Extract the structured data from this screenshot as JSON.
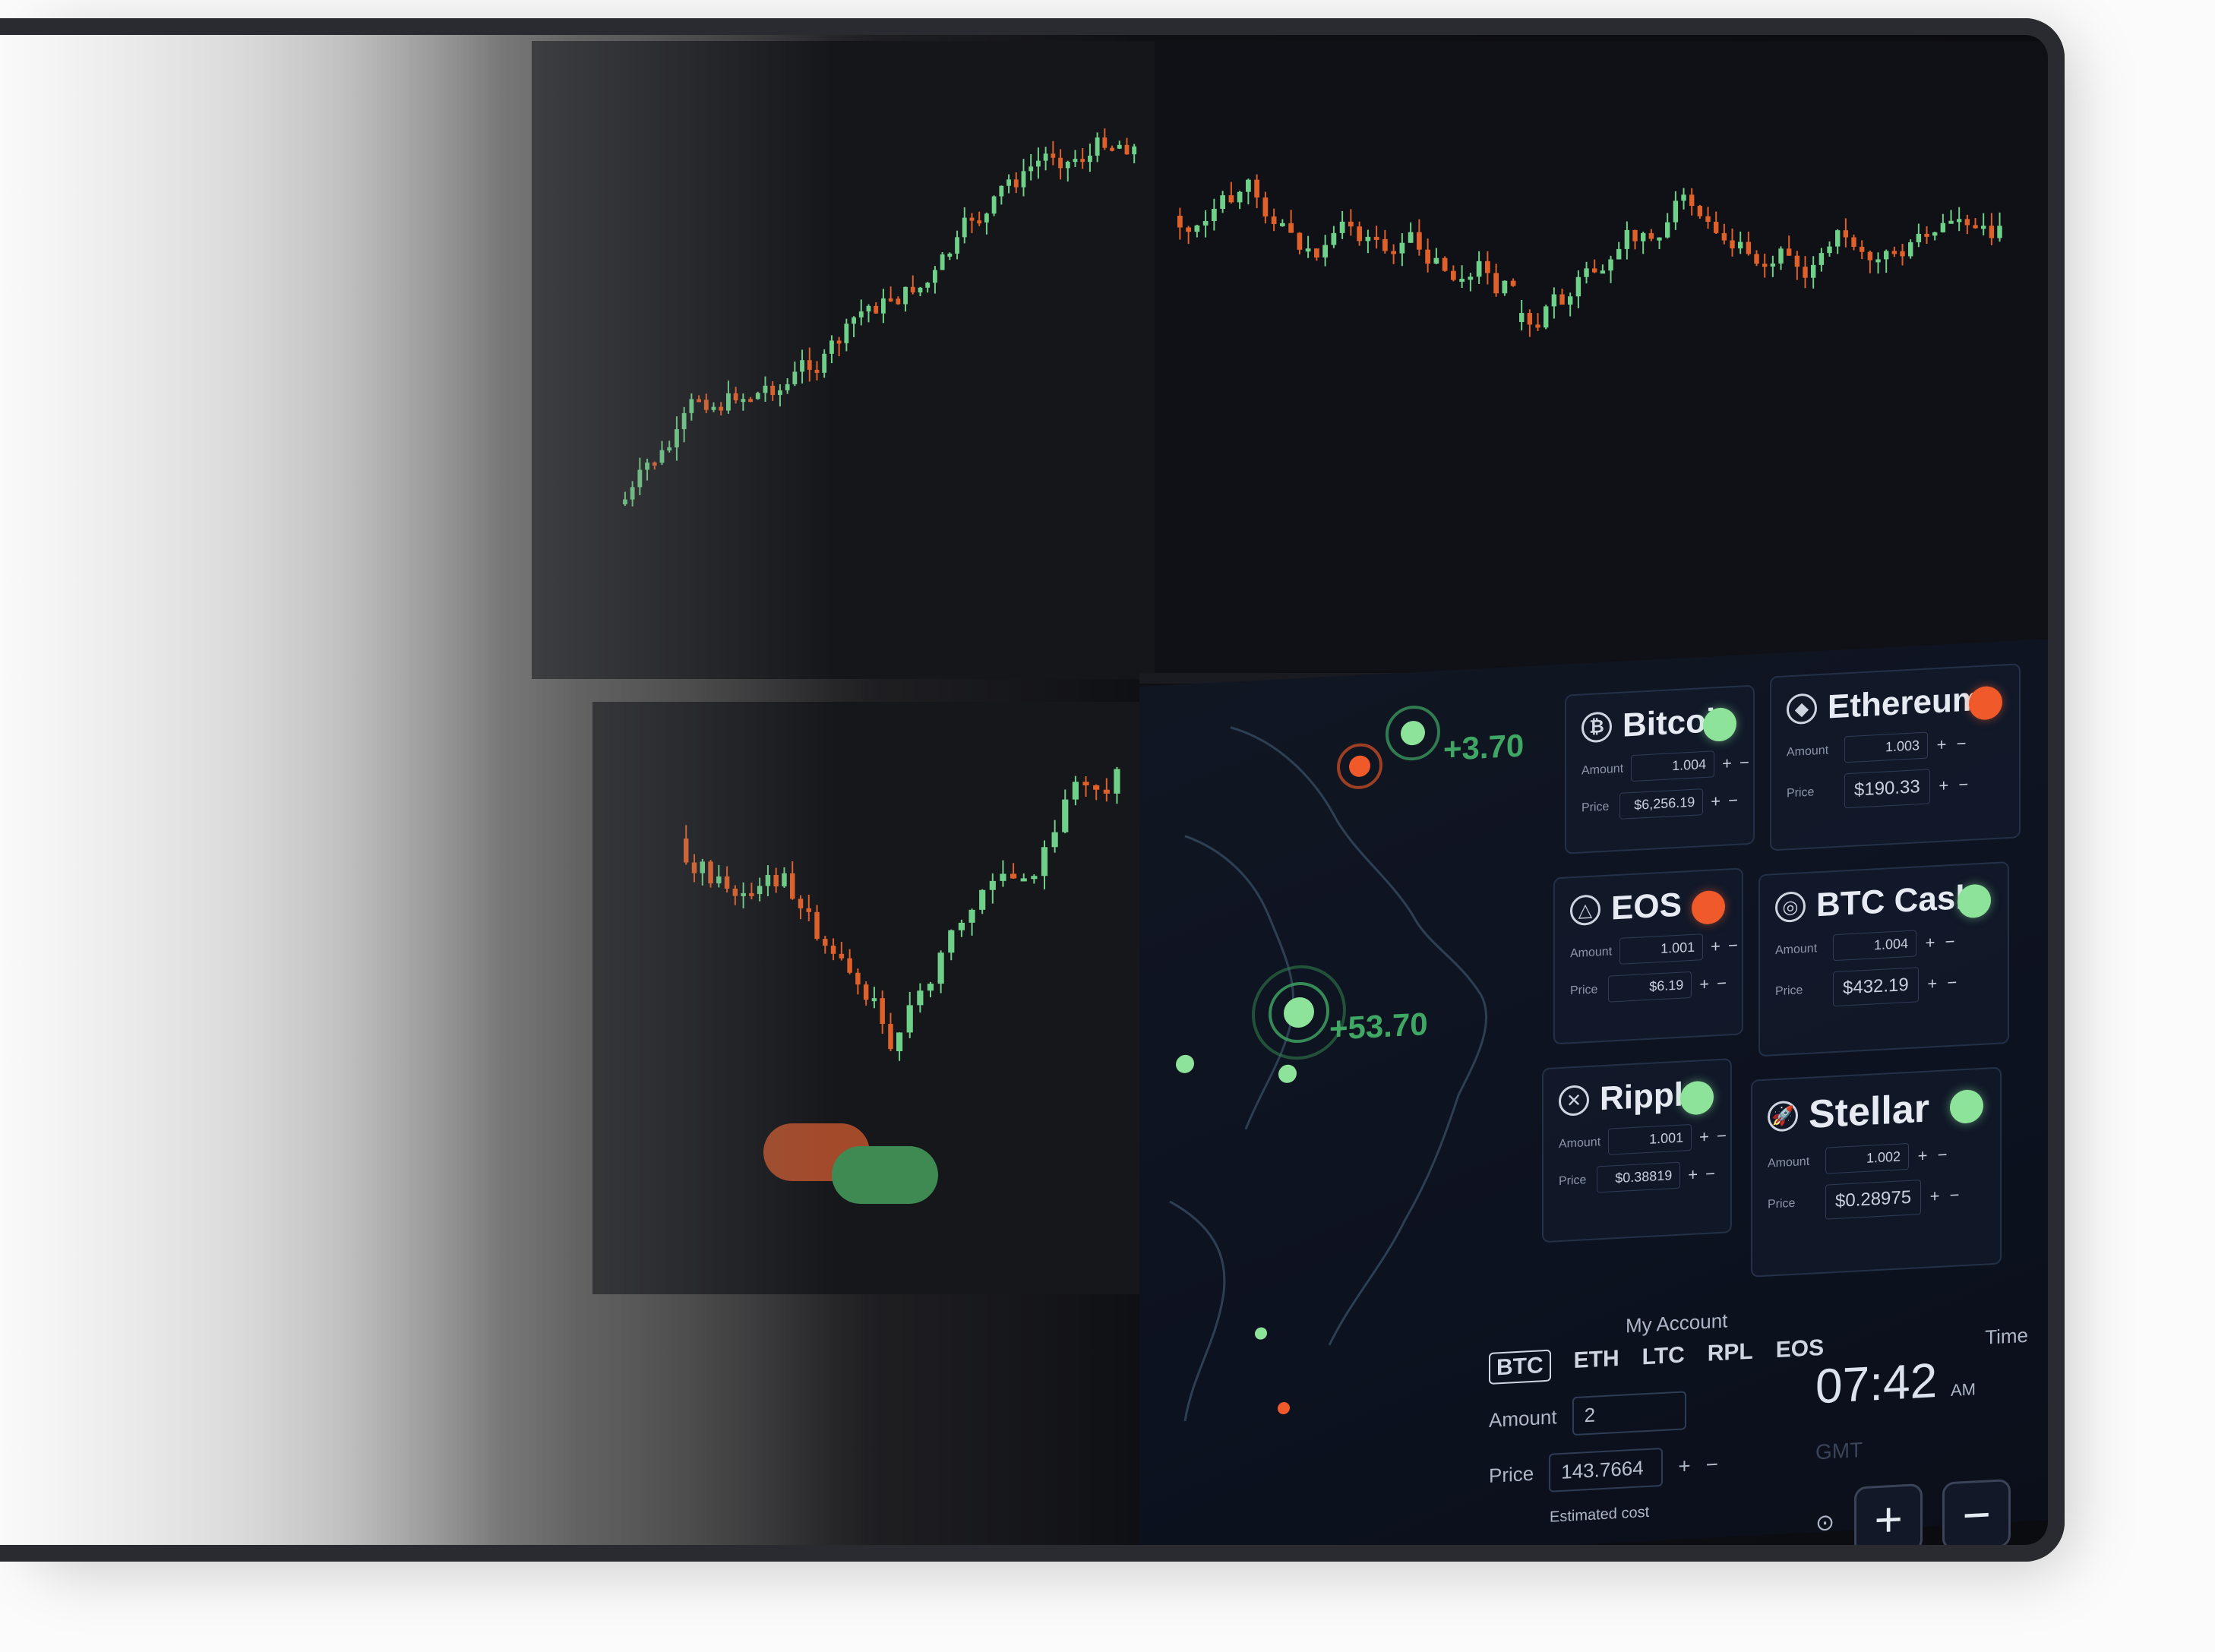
{
  "photo": {
    "alt_scene": "trading monitors"
  },
  "map": {
    "labels": [
      "+3.70",
      "+53.70"
    ]
  },
  "coins": [
    {
      "name": "Bitcoin",
      "icon": "bitcoin-icon",
      "status": "up",
      "amount": "1.004",
      "price": "$6,256.19"
    },
    {
      "name": "Ethereum",
      "icon": "ethereum-icon",
      "status": "down",
      "amount": "1.003",
      "price": "$190.33"
    },
    {
      "name": "EOS",
      "icon": "eos-icon",
      "status": "down",
      "amount": "1.001",
      "price": "$6.19"
    },
    {
      "name": "BTC Cash",
      "icon": "btc-cash-icon",
      "status": "up",
      "amount": "1.004",
      "price": "$432.19"
    },
    {
      "name": "Ripple",
      "icon": "ripple-icon",
      "status": "up",
      "amount": "1.001",
      "price": "$0.38819"
    },
    {
      "name": "Stellar",
      "icon": "stellar-icon",
      "status": "up",
      "amount": "1.002",
      "price": "$0.28975"
    }
  ],
  "labels": {
    "amount": "Amount",
    "price": "Price",
    "plus": "+",
    "minus": "−"
  },
  "account": {
    "title": "My Account",
    "tabs": [
      "BTC",
      "ETH",
      "LTC",
      "RPL",
      "EOS"
    ],
    "amount_label": "Amount",
    "amount_value": "2",
    "price_label": "Price",
    "price_value": "143.7664",
    "estimated_label": "Estimated cost"
  },
  "time": {
    "label": "Time",
    "value": "07:42",
    "ampm": "AM",
    "zone": "GMT"
  },
  "colors": {
    "up": "#8ee39a",
    "down": "#f05a2a",
    "candle_up": "#6fd08a",
    "candle_down": "#e0602a"
  }
}
